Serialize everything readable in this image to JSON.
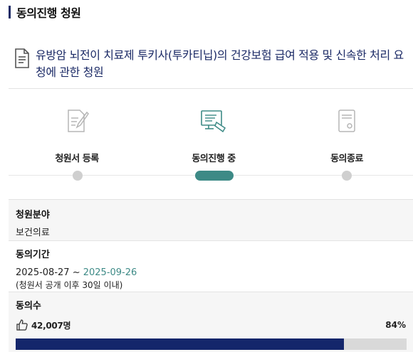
{
  "section_title": "동의진행 청원",
  "petition": {
    "title": "유방암 뇌전이 치료제 투키사(투카티닙)의 건강보험 급여 적용 및 신속한 처리 요청에 관한 청원"
  },
  "steps": [
    {
      "label": "청원서 등록",
      "icon": "pen-document-icon",
      "state": "done"
    },
    {
      "label": "동의진행 중",
      "icon": "monitor-signing-icon",
      "state": "active"
    },
    {
      "label": "동의종료",
      "icon": "document-seal-icon",
      "state": "pending"
    }
  ],
  "info": {
    "field_label": "청원분야",
    "field_value": "보건의료",
    "period_label": "동의기간",
    "period_start": "2025-08-27",
    "period_sep": " ~ ",
    "period_end": "2025-09-26",
    "period_note": "(청원서 공개 이후 30일 이내)",
    "votes_label": "동의수",
    "votes_count": "42,007명",
    "votes_percent": "84%",
    "votes_fraction": 0.84
  },
  "colors": {
    "navy": "#1b2a66",
    "progress_fill": "#14266b",
    "teal": "#3d8a86",
    "gray_dot": "#cfcfcf"
  }
}
